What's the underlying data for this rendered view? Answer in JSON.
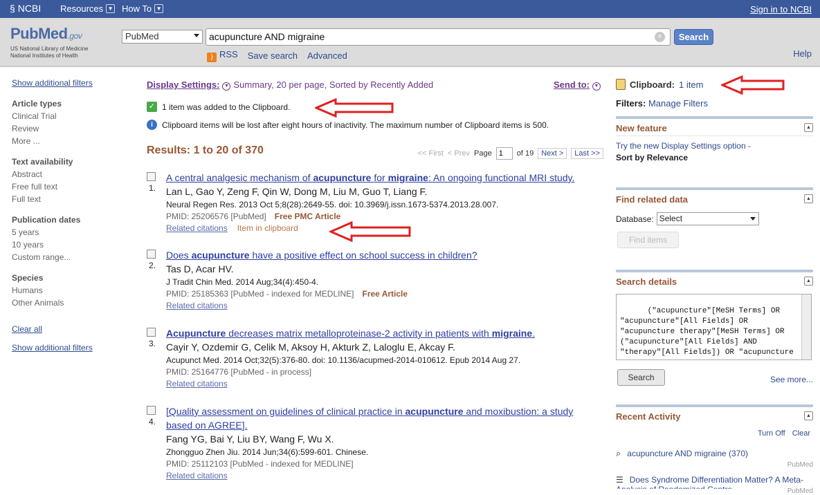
{
  "topbar": {
    "brand": "NCBI",
    "resources": "Resources",
    "howto": "How To",
    "signin": "Sign in to NCBI"
  },
  "logo": {
    "pub": "Pub",
    "med": "Med",
    "gov": ".gov",
    "sub1": "US National Library of Medicine",
    "sub2": "National Institutes of Health"
  },
  "search": {
    "db": "PubMed",
    "query": "acupuncture AND migraine",
    "button": "Search",
    "rss": "RSS",
    "save": "Save search",
    "advanced": "Advanced",
    "help": "Help"
  },
  "left": {
    "show_filters": "Show additional filters",
    "groups": [
      {
        "title": "Article types",
        "items": [
          "Clinical Trial",
          "Review",
          "More ..."
        ]
      },
      {
        "title": "Text availability",
        "items": [
          "Abstract",
          "Free full text",
          "Full text"
        ]
      },
      {
        "title": "Publication dates",
        "items": [
          "5 years",
          "10 years",
          "Custom range..."
        ]
      },
      {
        "title": "Species",
        "items": [
          "Humans",
          "Other Animals"
        ]
      }
    ],
    "clear_all": "Clear all",
    "show_filters2": "Show additional filters"
  },
  "display": {
    "label": "Display Settings:",
    "summary": "Summary, 20 per page, Sorted by Recently Added",
    "sendto": "Send to:"
  },
  "messages": {
    "added": "1 item was added to the Clipboard.",
    "info": "Clipboard items will be lost after eight hours of inactivity. The maximum number of Clipboard items is 500."
  },
  "results": {
    "title": "Results: 1 to 20 of 370",
    "first": "<< First",
    "prev": "< Prev",
    "page_label": "Page",
    "page": "1",
    "of": "of 19",
    "next": "Next >",
    "last": "Last >>"
  },
  "items": [
    {
      "num": "1.",
      "t1": "A central analgesic mechanism of ",
      "b1": "acupuncture",
      "t2": " for ",
      "b2": "migraine",
      "t3": ": An ongoing functional MRI study.",
      "authors": "Lan L, Gao Y, Zeng F, Qin W, Dong M, Liu M, Guo T, Liang F.",
      "journal": "Neural Regen Res. 2013 Oct 5;8(28):2649-55. doi: 10.3969/j.issn.1673-5374.2013.28.007.",
      "pmid": "PMID: 25206576 [PubMed]",
      "free": "Free PMC Article",
      "related": "Related citations",
      "inclip": "Item in clipboard"
    },
    {
      "num": "2.",
      "t1": "Does ",
      "b1": "acupuncture",
      "t2": " have a positive effect on school success in children?",
      "authors": "Tas D, Acar HV.",
      "journal": "J Tradit Chin Med. 2014 Aug;34(4):450-4.",
      "pmid": "PMID: 25185363 [PubMed - indexed for MEDLINE]",
      "free": "Free Article",
      "related": "Related citations"
    },
    {
      "num": "3.",
      "b1": "Acupuncture",
      "t2": " decreases matrix metalloproteinase-2 activity in patients with ",
      "b2": "migraine",
      "t3": ".",
      "authors": "Cayir Y, Ozdemir G, Celik M, Aksoy H, Akturk Z, Laloglu E, Akcay F.",
      "journal": "Acupunct Med. 2014 Oct;32(5):376-80. doi: 10.1136/acupmed-2014-010612. Epub 2014 Aug 27.",
      "pmid": "PMID: 25164776 [PubMed - in process]",
      "related": "Related citations"
    },
    {
      "num": "4.",
      "t1": "[Quality assessment on guidelines of clinical practice in ",
      "b1": "acupuncture",
      "t2": " and moxibustion: a study based on AGREE].",
      "authors": "Fang YG, Bai Y, Liu BY, Wang F, Wu X.",
      "journal": "Zhongguo Zhen Jiu. 2014 Jun;34(6):599-601. Chinese.",
      "pmid": "PMID: 25112103 [PubMed - indexed for MEDLINE]",
      "related": "Related citations"
    }
  ],
  "right": {
    "clipboard_label": "Clipboard:",
    "clipboard_link": "1 item",
    "filters_label": "Filters:",
    "filters_link": "Manage Filters",
    "newfeature": {
      "title": "New feature",
      "text": "Try the new Display Settings option -",
      "bold": "Sort by Relevance"
    },
    "related": {
      "title": "Find related data",
      "db_label": "Database:",
      "db_value": "Select",
      "button": "Find items"
    },
    "details": {
      "title": "Search details",
      "query": "(\"acupuncture\"[MeSH Terms] OR \"acupuncture\"[All Fields] OR \"acupuncture therapy\"[MeSH Terms] OR (\"acupuncture\"[All Fields] AND \"therapy\"[All Fields]) OR \"acupuncture",
      "button": "Search",
      "seemore": "See more..."
    },
    "recent": {
      "title": "Recent Activity",
      "turnoff": "Turn Off",
      "clear": "Clear",
      "item1": "acupuncture AND migraine (370)",
      "src1": "PubMed",
      "item2": "Does Syndrome Differentiation Matter? A Meta-Analysis of Randomized Contro",
      "src2": "PubMed"
    }
  }
}
